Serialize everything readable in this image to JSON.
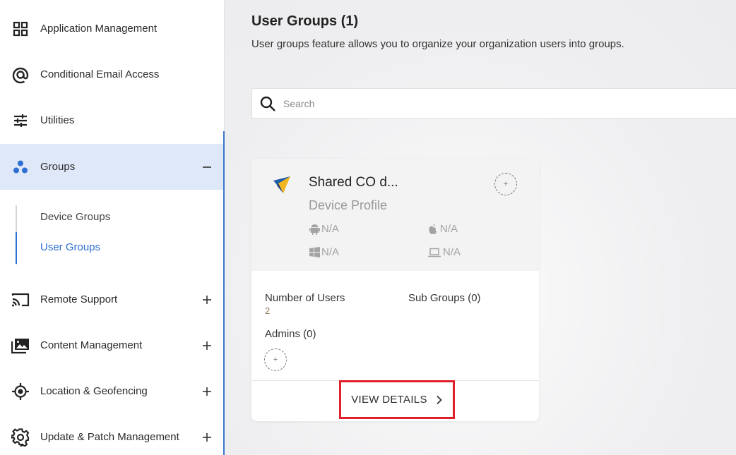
{
  "sidebar": {
    "items": [
      {
        "label": "Application Management",
        "icon": "grid-icon"
      },
      {
        "label": "Conditional Email Access",
        "icon": "at-sign-icon"
      },
      {
        "label": "Utilities",
        "icon": "sliders-icon"
      },
      {
        "label": "Groups",
        "icon": "groups-icon",
        "toggle": "−"
      },
      {
        "label": "Remote Support",
        "icon": "cast-icon",
        "toggle": "+"
      },
      {
        "label": "Content Management",
        "icon": "photo-library-icon",
        "toggle": "+"
      },
      {
        "label": "Location & Geofencing",
        "icon": "location-target-icon",
        "toggle": "+"
      },
      {
        "label": "Update & Patch Management",
        "icon": "gear-icon",
        "toggle": "+"
      }
    ],
    "sub_items": [
      {
        "label": "Device Groups"
      },
      {
        "label": "User Groups"
      }
    ],
    "active_item": "Groups",
    "active_sub_item": "User Groups"
  },
  "main": {
    "title": "User Groups (1)",
    "description": "User groups feature allows you to organize your organization users into groups.",
    "search": {
      "placeholder": "Search",
      "value": ""
    }
  },
  "card": {
    "name": "Shared CO d...",
    "profile": "Device Profile",
    "os": {
      "android": "N/A",
      "apple": "N/A",
      "windows": "N/A",
      "laptop": "N/A"
    },
    "stats": {
      "users_label": "Number of Users",
      "users_value": "2",
      "subgroups_label": "Sub Groups (0)",
      "admins_label": "Admins (0)"
    },
    "add_symbol": "+",
    "view_details_label": "VIEW DETAILS"
  },
  "colors": {
    "accent": "#2f6fd1",
    "active_bg": "#dfe8f8",
    "highlight_border": "#e0202c"
  }
}
